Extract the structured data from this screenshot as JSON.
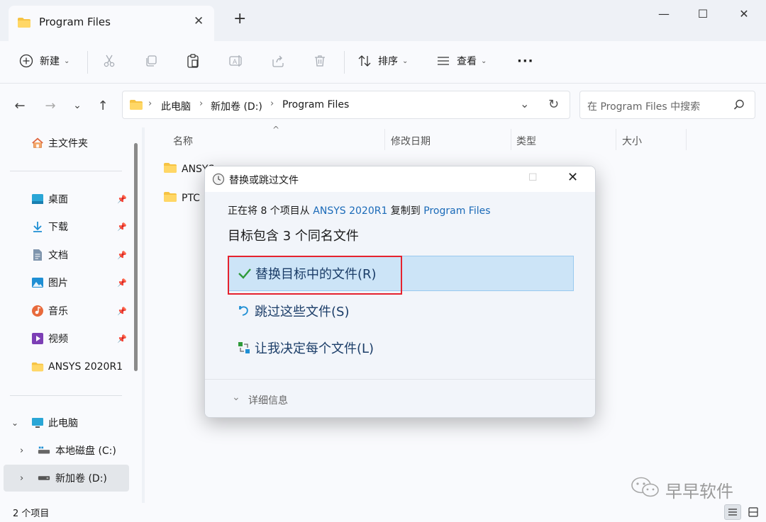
{
  "window": {
    "tab_title": "Program Files",
    "new_tab": "+",
    "minimize": "—",
    "maximize": "☐",
    "close": "✕"
  },
  "toolbar": {
    "new_label": "新建",
    "sort_label": "排序",
    "view_label": "查看",
    "more": "···"
  },
  "address": {
    "breadcrumbs": [
      "此电脑",
      "新加卷 (D:)",
      "Program Files"
    ],
    "search_placeholder": "在 Program Files 中搜索"
  },
  "sidebar": {
    "home": "主文件夹",
    "quick": [
      {
        "label": "桌面",
        "icon": "desktop-icon"
      },
      {
        "label": "下载",
        "icon": "download-icon"
      },
      {
        "label": "文档",
        "icon": "document-icon"
      },
      {
        "label": "图片",
        "icon": "pictures-icon"
      },
      {
        "label": "音乐",
        "icon": "music-icon"
      },
      {
        "label": "视频",
        "icon": "video-icon"
      },
      {
        "label": "ANSYS 2020R1",
        "icon": "folder-icon"
      }
    ],
    "this_pc": "此电脑",
    "drives": [
      "本地磁盘 (C:)",
      "新加卷 (D:)"
    ]
  },
  "content": {
    "columns": [
      "名称",
      "修改日期",
      "类型",
      "大小"
    ],
    "files": [
      "ANSYS",
      "PTC"
    ]
  },
  "status": {
    "count": "2 个项目"
  },
  "dialog": {
    "title": "替换或跳过文件",
    "copy_prefix": "正在将 8 个项目从 ",
    "source": "ANSYS 2020R1",
    "copy_mid": " 复制到 ",
    "dest": "Program Files",
    "heading": "目标包含 3 个同名文件",
    "options": [
      {
        "label": "替换目标中的文件(R)",
        "icon": "checkmark-icon"
      },
      {
        "label": "跳过这些文件(S)",
        "icon": "skip-icon"
      },
      {
        "label": "让我决定每个文件(L)",
        "icon": "compare-icon"
      }
    ],
    "details": "详细信息"
  },
  "watermark": "早早软件",
  "colors": {
    "accent": "#1a6ab8",
    "selected_bg": "#cce4f7",
    "highlight_box": "#e5222e"
  }
}
